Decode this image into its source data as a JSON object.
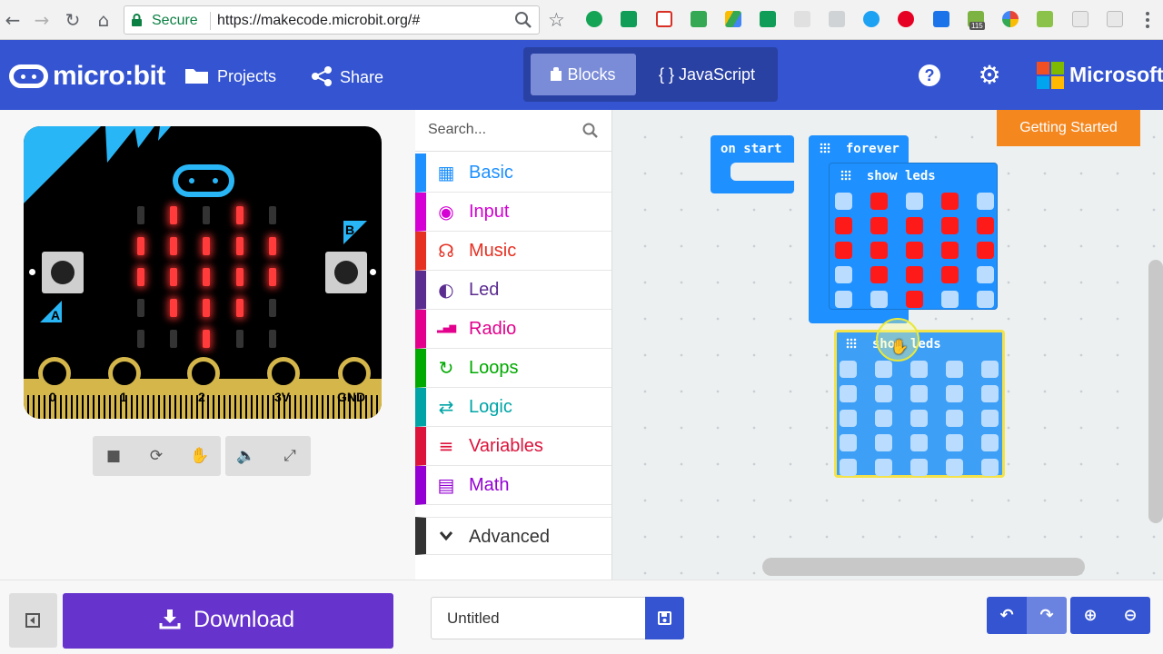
{
  "browser": {
    "secure_label": "Secure",
    "url": "https://makecode.microbit.org/#",
    "extension_badge": "115"
  },
  "header": {
    "brand": "micro:bit",
    "projects_label": "Projects",
    "share_label": "Share",
    "blocks_tab": "Blocks",
    "javascript_tab": "{ } JavaScript",
    "help_glyph": "?",
    "microsoft_label": "Microsoft",
    "accent_color": "#3454d1"
  },
  "simulator": {
    "pins": [
      "0",
      "1",
      "2",
      "3V",
      "GND"
    ],
    "button_a": "A",
    "button_b": "B",
    "led_matrix": [
      [
        0,
        1,
        0,
        1,
        0
      ],
      [
        1,
        1,
        1,
        1,
        1
      ],
      [
        1,
        1,
        1,
        1,
        1
      ],
      [
        0,
        1,
        1,
        1,
        0
      ],
      [
        0,
        0,
        1,
        0,
        0
      ]
    ]
  },
  "toolbox": {
    "search_placeholder": "Search...",
    "categories": [
      {
        "label": "Basic",
        "color": "#1e90ff",
        "icon": "grid-icon"
      },
      {
        "label": "Input",
        "color": "#d400d4",
        "icon": "target-icon"
      },
      {
        "label": "Music",
        "color": "#e63022",
        "icon": "headphones-icon"
      },
      {
        "label": "Led",
        "color": "#5c2d91",
        "icon": "toggle-icon"
      },
      {
        "label": "Radio",
        "color": "#e3008c",
        "icon": "signal-icon"
      },
      {
        "label": "Loops",
        "color": "#00aa00",
        "icon": "refresh-icon"
      },
      {
        "label": "Logic",
        "color": "#00a4a6",
        "icon": "shuffle-icon"
      },
      {
        "label": "Variables",
        "color": "#dc143c",
        "icon": "lines-icon"
      },
      {
        "label": "Math",
        "color": "#9400d3",
        "icon": "calculator-icon"
      }
    ],
    "advanced_label": "Advanced"
  },
  "workspace": {
    "getting_started": "Getting Started",
    "on_start_label": "on start",
    "forever_label": "forever",
    "show_leds_label": "show leds",
    "show_leds_1": [
      [
        0,
        1,
        0,
        1,
        0
      ],
      [
        1,
        1,
        1,
        1,
        1
      ],
      [
        1,
        1,
        1,
        1,
        1
      ],
      [
        0,
        1,
        1,
        1,
        0
      ],
      [
        0,
        0,
        1,
        0,
        0
      ]
    ],
    "show_leds_2": [
      [
        0,
        0,
        0,
        0,
        0
      ],
      [
        0,
        0,
        0,
        0,
        0
      ],
      [
        0,
        0,
        0,
        0,
        0
      ],
      [
        0,
        0,
        0,
        0,
        0
      ],
      [
        0,
        0,
        0,
        0,
        0
      ]
    ]
  },
  "bottom": {
    "download_label": "Download",
    "project_name": "Untitled"
  }
}
